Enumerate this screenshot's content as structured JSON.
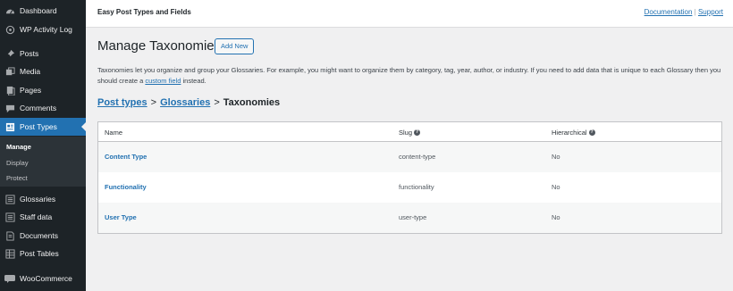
{
  "sidebar": {
    "top_items": [
      {
        "label": "Dashboard",
        "icon": "dashboard-icon"
      },
      {
        "label": "WP Activity Log",
        "icon": "activity-log-icon"
      },
      {
        "label": "Posts",
        "icon": "pin-icon"
      },
      {
        "label": "Media",
        "icon": "media-icon"
      },
      {
        "label": "Pages",
        "icon": "pages-icon"
      },
      {
        "label": "Comments",
        "icon": "comments-icon"
      },
      {
        "label": "Post Types",
        "icon": "post-types-icon"
      }
    ],
    "submenu": [
      "Manage",
      "Display",
      "Protect"
    ],
    "bottom_items": [
      {
        "label": "Glossaries",
        "icon": "list-icon"
      },
      {
        "label": "Staff data",
        "icon": "list-icon"
      },
      {
        "label": "Documents",
        "icon": "document-icon"
      },
      {
        "label": "Post Tables",
        "icon": "table-icon"
      },
      {
        "label": "WooCommerce",
        "icon": "woocommerce-icon"
      }
    ]
  },
  "header": {
    "plugin_title": "Easy Post Types and Fields",
    "documentation_link": "Documentation",
    "separator": "|",
    "support_link": "Support"
  },
  "main": {
    "title": "Manage Taxonomies",
    "add_new_label": "Add New",
    "description_before": "Taxonomies let you organize and group your Glossaries. For example, you might want to organize them by category, tag, year, author, or industry. If you need to add data that is unique to each Glossary then you should create a ",
    "description_link": "custom field",
    "description_after": " instead.",
    "breadcrumb": {
      "post_types": "Post types",
      "sep": ">",
      "glossaries": "Glossaries",
      "current": "Taxonomies"
    },
    "table": {
      "headers": {
        "name": "Name",
        "slug": "Slug",
        "hierarchical": "Hierarchical"
      },
      "rows": [
        {
          "name": "Content Type",
          "slug": "content-type",
          "hierarchical": "No"
        },
        {
          "name": "Functionality",
          "slug": "functionality",
          "hierarchical": "No"
        },
        {
          "name": "User Type",
          "slug": "user-type",
          "hierarchical": "No"
        }
      ]
    }
  },
  "colors": {
    "sidebar_bg": "#1d2327",
    "accent": "#2271b1",
    "page_bg": "#f0f0f1"
  }
}
